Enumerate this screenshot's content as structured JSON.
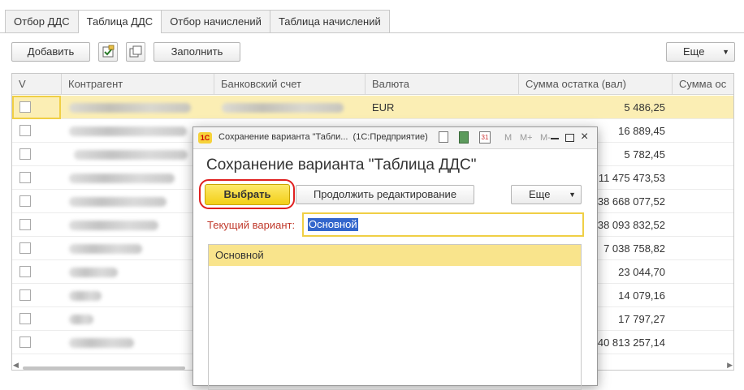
{
  "tabs": [
    "Отбор ДДС",
    "Таблица ДДС",
    "Отбор начислений",
    "Таблица начислений"
  ],
  "toolbar": {
    "add": "Добавить",
    "fill": "Заполнить",
    "more": "Еще"
  },
  "table": {
    "columns": [
      "V",
      "Контрагент",
      "Банковский счет",
      "Валюта",
      "Сумма остатка (вал)",
      "Сумма ос"
    ],
    "rows": [
      {
        "currency": "EUR",
        "amount": "5 486,25"
      },
      {
        "currency": "",
        "amount": "16 889,45"
      },
      {
        "currency": "",
        "amount": "5 782,45"
      },
      {
        "currency": "",
        "amount": "11 475 473,53"
      },
      {
        "currency": "",
        "amount": "38 668 077,52"
      },
      {
        "currency": "",
        "amount": "38 093 832,52"
      },
      {
        "currency": "",
        "amount": "7 038 758,82"
      },
      {
        "currency": "",
        "amount": "23 044,70"
      },
      {
        "currency": "",
        "amount": "14 079,16"
      },
      {
        "currency": "",
        "amount": "17 797,27"
      },
      {
        "currency": "",
        "amount": "40 813 257,14"
      }
    ]
  },
  "dialog": {
    "window_title": "Сохранение варианта \"Табли...  (1С:Предприятие)",
    "heading": "Сохранение варианта \"Таблица ДДС\"",
    "select_button": "Выбрать",
    "continue_button": "Продолжить редактирование",
    "more": "Еще",
    "current_label": "Текущий вариант:",
    "current_value": "Основной",
    "variants": [
      "Основной"
    ],
    "title_buttons": {
      "m": "M",
      "mplus": "M+",
      "mminus": "M-"
    }
  }
}
